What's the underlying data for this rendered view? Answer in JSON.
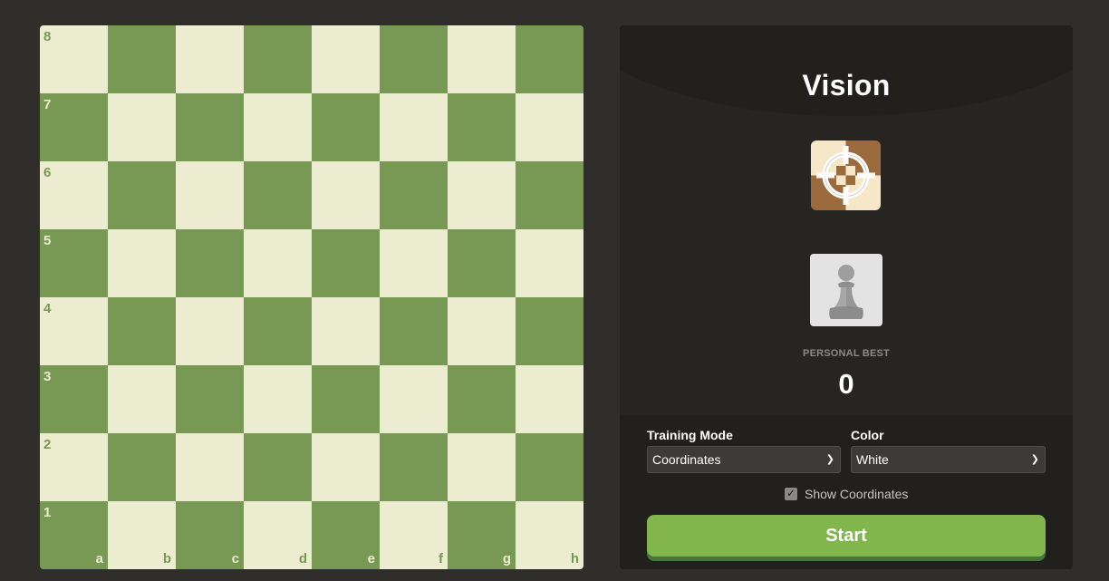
{
  "board": {
    "ranks": [
      "8",
      "7",
      "6",
      "5",
      "4",
      "3",
      "2",
      "1"
    ],
    "files": [
      "a",
      "b",
      "c",
      "d",
      "e",
      "f",
      "g",
      "h"
    ],
    "light_color": "#ebecd0",
    "dark_color": "#779954"
  },
  "panel": {
    "title": "Vision",
    "vision_icon": "crosshair-target-icon",
    "avatar_icon": "pawn-icon",
    "personal_best_label": "PERSONAL BEST",
    "personal_best_value": "0"
  },
  "controls": {
    "training_mode_label": "Training Mode",
    "training_mode_value": "Coordinates",
    "color_label": "Color",
    "color_value": "White",
    "show_coordinates_label": "Show Coordinates",
    "show_coordinates_checked": true,
    "start_label": "Start"
  },
  "colors": {
    "background": "#302e2b",
    "panel": "#262522",
    "start_button": "#81b64c"
  }
}
